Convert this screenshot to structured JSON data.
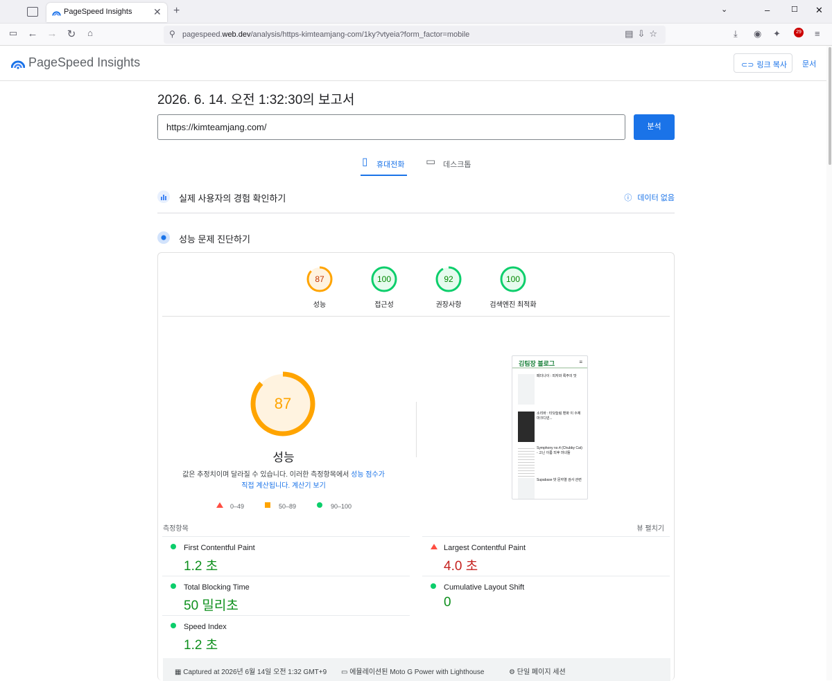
{
  "browser": {
    "tab_title": "PageSpeed Insights",
    "tab_close": "✕",
    "new_tab": "+",
    "url_host_prefix": "pagespeed.",
    "url_host": "web.dev",
    "url_path": "/analysis/https-kimteamjang-com/1ky?vtyeia?form_factor=mobile",
    "ext_badge": "29"
  },
  "header": {
    "logo_text": "PageSpeed Insights",
    "copy_link_label": "링크 복사",
    "docs_label": "문서"
  },
  "report": {
    "title": "2026. 6. 14. 오전 1:32:30의 보고서",
    "url_value": "https://kimteamjang.com/",
    "analyze_label": "분석",
    "tab_mobile": "휴대전화",
    "tab_desktop": "데스크톱"
  },
  "field": {
    "label": "실제 사용자의 경험 확인하기",
    "no_data": "데이터 없음"
  },
  "diagnose": {
    "label": "성능 문제 진단하기"
  },
  "scores": [
    {
      "label": "성능",
      "value": "87",
      "fraction": 0.87,
      "color": "#ffa400",
      "text_color": "#c33300"
    },
    {
      "label": "접근성",
      "value": "100",
      "fraction": 1.0,
      "color": "#0cce6b",
      "text_color": "#008800"
    },
    {
      "label": "권장사항",
      "value": "92",
      "fraction": 0.92,
      "color": "#0cce6b",
      "text_color": "#008800"
    },
    {
      "label": "검색엔진 최적화",
      "value": "100",
      "fraction": 1.0,
      "color": "#0cce6b",
      "text_color": "#008800"
    }
  ],
  "performance": {
    "score": "87",
    "fraction": 0.87,
    "label": "성능",
    "note_1": "값은 추정치이며 달라질 수 있습니다. 이러한 측정항목에서 ",
    "note_link_1": "성능 점수가",
    "note_link_2": "직접 계산됩니다.",
    "note_link_3": "계산기 보기",
    "legend": [
      "0–49",
      "50–89",
      "90–100"
    ]
  },
  "preview": {
    "site_title": "김팀장 블로그",
    "menu_icon": "≡",
    "posts": [
      {
        "text": "페더나이 : 피자와 록주의 맛"
      },
      {
        "text": "소리바 : 타닷늘림 밴화 이 수제마크디넨..."
      },
      {
        "text": "Symphony no.4 (Chubby Cat) - 고닌 이름 되후 마녀들"
      },
      {
        "text": "Supabase 밧 문자열 검사 관련"
      }
    ]
  },
  "metrics": {
    "section_label": "측정항목",
    "expand_label": "뷰 펼치기",
    "items": [
      {
        "name": "First Contentful Paint",
        "value": "1.2 초",
        "status": "good",
        "color": "#0d8f1c"
      },
      {
        "name": "Largest Contentful Paint",
        "value": "4.0 초",
        "status": "poor",
        "color": "#c5221f"
      },
      {
        "name": "Total Blocking Time",
        "value": "50 밀리초",
        "status": "good",
        "color": "#0d8f1c"
      },
      {
        "name": "Cumulative Layout Shift",
        "value": "0",
        "status": "good",
        "color": "#0d8f1c"
      },
      {
        "name": "Speed Index",
        "value": "1.2 초",
        "status": "good",
        "color": "#0d8f1c"
      }
    ]
  },
  "footer": {
    "captured": "Captured at 2026년 6월 14일 오전 1:32 GMT+9",
    "device": "에뮬레이션된 Moto G Power with Lighthouse",
    "session": "단일 페이지 세션"
  },
  "colors": {
    "accent": "#1a73e8",
    "good": "#0cce6b",
    "average": "#ffa400",
    "poor": "#ff4e42"
  }
}
